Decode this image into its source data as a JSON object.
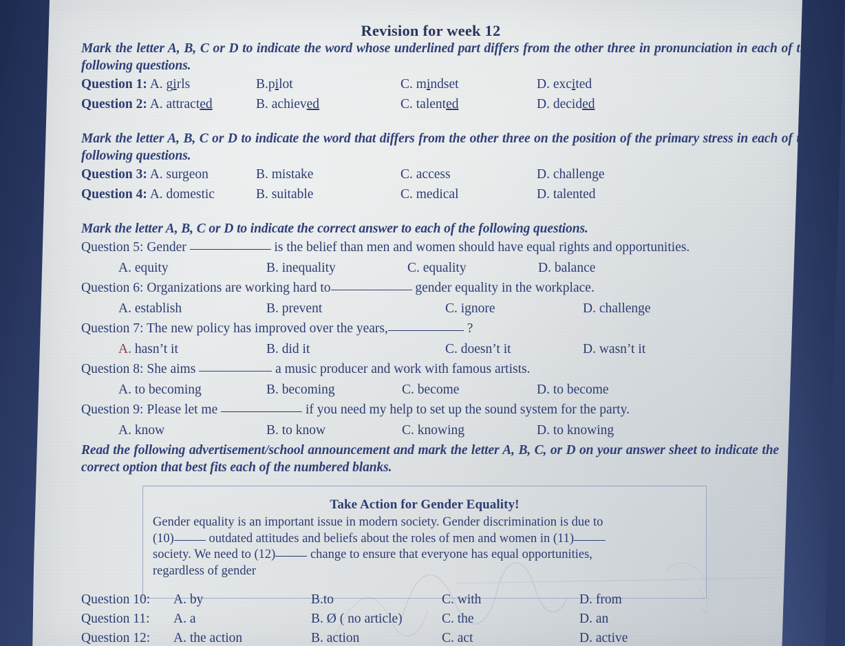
{
  "document": {
    "title": "Revision for week 12"
  },
  "sections": [
    {
      "id": "pronunciation",
      "instruction": "Mark the letter A, B, C or D to indicate the word whose underlined part differs from the other three in pronunciation in each of the following questions.",
      "questions": [
        {
          "label": "Question 1:",
          "options": [
            {
              "letter": "A.",
              "pre": "g",
              "ul": "i",
              "post": "rls"
            },
            {
              "letter": "B.",
              "pre": "p",
              "ul": "i",
              "post": "lot"
            },
            {
              "letter": "C.",
              "pre": "m",
              "ul": "i",
              "post": "ndset"
            },
            {
              "letter": "D.",
              "pre": "exc",
              "ul": "i",
              "post": "ted"
            }
          ]
        },
        {
          "label": "Question 2:",
          "options": [
            {
              "letter": "A.",
              "pre": "attract",
              "ul": "ed",
              "post": ""
            },
            {
              "letter": "B.",
              "pre": "achiev",
              "ul": "ed",
              "post": ""
            },
            {
              "letter": "C.",
              "pre": "talent",
              "ul": "ed",
              "post": ""
            },
            {
              "letter": "D.",
              "pre": "decid",
              "ul": "ed",
              "post": ""
            }
          ]
        }
      ]
    },
    {
      "id": "stress",
      "instruction": "Mark the letter A, B, C or D to indicate the word that differs from the other three on the position of the primary stress in each of the following questions.",
      "questions": [
        {
          "label": "Question 3:",
          "options": [
            {
              "letter": "A.",
              "text": "surgeon"
            },
            {
              "letter": "B.",
              "text": "mistake"
            },
            {
              "letter": "C.",
              "text": "access"
            },
            {
              "letter": "D.",
              "text": "challenge"
            }
          ]
        },
        {
          "label": "Question 4:",
          "options": [
            {
              "letter": "A.",
              "text": "domestic"
            },
            {
              "letter": "B.",
              "text": "suitable"
            },
            {
              "letter": "C.",
              "text": "medical"
            },
            {
              "letter": "D.",
              "text": "talented"
            }
          ]
        }
      ]
    }
  ],
  "multiple_choice": {
    "instruction": "Mark the letter A, B, C or D to indicate the correct answer to each of the following questions.",
    "items": [
      {
        "label": "Question 5:",
        "stem_before": "Gender",
        "stem_after": "is the belief than men and women should have equal rights and opportunities.",
        "options": [
          {
            "letter": "A.",
            "text": "equity"
          },
          {
            "letter": "B.",
            "text": "inequality"
          },
          {
            "letter": "C.",
            "text": "equality"
          },
          {
            "letter": "D.",
            "text": "balance"
          }
        ]
      },
      {
        "label": "Question 6:",
        "stem_before": "Organizations are working hard to",
        "stem_after": "gender equality in the workplace.",
        "options": [
          {
            "letter": "A.",
            "text": "establish"
          },
          {
            "letter": "B.",
            "text": "prevent"
          },
          {
            "letter": "C.",
            "text": "ignore"
          },
          {
            "letter": "D.",
            "text": "challenge"
          }
        ]
      },
      {
        "label": "Question 7:",
        "stem_before": "The new policy has improved over the years,",
        "stem_after": "?",
        "options": [
          {
            "letter": "A.",
            "text": "hasn’t it",
            "letter_color": "#8e3d4a"
          },
          {
            "letter": "B.",
            "text": "did it"
          },
          {
            "letter": "C.",
            "text": "doesn’t it"
          },
          {
            "letter": "D.",
            "text": "wasn’t it"
          }
        ]
      },
      {
        "label": "Question 8:",
        "stem_before": "She aims",
        "stem_after": "a music producer and work with famous artists.",
        "options": [
          {
            "letter": "A.",
            "text": "to becoming"
          },
          {
            "letter": "B.",
            "text": "becoming"
          },
          {
            "letter": "C.",
            "text": "become"
          },
          {
            "letter": "D.",
            "text": "to become"
          }
        ]
      },
      {
        "label": "Question 9:",
        "stem_before": "Please let me",
        "stem_after": "if you need my help to set up the sound system for the party.",
        "options": [
          {
            "letter": "A.",
            "text": "know"
          },
          {
            "letter": "B.",
            "text": "to know"
          },
          {
            "letter": "C.",
            "text": "knowing"
          },
          {
            "letter": "D.",
            "text": "to knowing"
          }
        ]
      }
    ]
  },
  "reading": {
    "instruction": "Read the following advertisement/school announcement and mark the letter A, B, C, or D on your answer sheet to indicate the correct option that best fits each of the numbered blanks.",
    "passage": {
      "title": "Take Action for Gender Equality!",
      "line1": "Gender equality is an important issue in modern society. Gender discrimination is due to",
      "blank10": "(10)",
      "line2": "outdated attitudes and beliefs about the roles of men and women in (11)",
      "line3_before": "society. We need to (12)",
      "line3_after": "change to ensure that everyone has equal opportunities,",
      "line4": "regardless of gender"
    },
    "questions": [
      {
        "label": "Question 10:",
        "options": [
          {
            "letter": "A.",
            "text": "by"
          },
          {
            "letter": "B.",
            "text": "to"
          },
          {
            "letter": "C.",
            "text": "with"
          },
          {
            "letter": "D.",
            "text": "from"
          }
        ]
      },
      {
        "label": "Question 11:",
        "options": [
          {
            "letter": "A.",
            "text": "a"
          },
          {
            "letter": "B.",
            "text": "Ø ( no article)"
          },
          {
            "letter": "C.",
            "text": "the"
          },
          {
            "letter": "D.",
            "text": "an"
          }
        ]
      },
      {
        "label": "Question 12:",
        "options": [
          {
            "letter": "A.",
            "text": "the action"
          },
          {
            "letter": "B.",
            "text": "action"
          },
          {
            "letter": "C.",
            "text": "act"
          },
          {
            "letter": "D.",
            "text": "active"
          }
        ]
      }
    ]
  },
  "colors": {
    "ink": "#2c3d72",
    "paper": "#dfe3e4",
    "frame": "#2c3b66",
    "box_border": "#9aa7c4",
    "accent_red": "#8e3d4a"
  }
}
